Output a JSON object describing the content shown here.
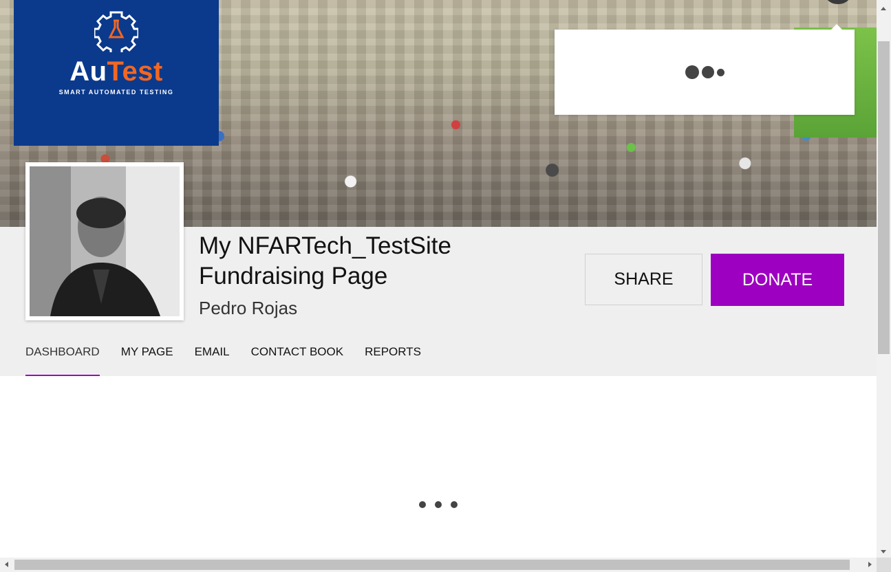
{
  "header": {
    "logo": {
      "wordmark_part1": "Au",
      "wordmark_part2": "Test",
      "tagline": "SMART AUTOMATED TESTING",
      "icon": "gear-flask-icon",
      "background_color": "#0b3a8c",
      "accent_color": "#f26722"
    },
    "cover_photo": "crowd-walking-event-photo",
    "user_menu_popup": {
      "state": "loading"
    }
  },
  "profile": {
    "photo": "profile-photo",
    "page_title": "My NFARTech_TestSite Fundraising Page",
    "owner_name": "Pedro Rojas"
  },
  "actions": {
    "share_label": "SHARE",
    "donate_label": "DONATE",
    "donate_color": "#9d00c0"
  },
  "tabs": [
    {
      "label": "DASHBOARD",
      "active": true
    },
    {
      "label": "MY PAGE",
      "active": false
    },
    {
      "label": "EMAIL",
      "active": false
    },
    {
      "label": "CONTACT BOOK",
      "active": false
    },
    {
      "label": "REPORTS",
      "active": false
    }
  ],
  "content": {
    "state": "loading"
  }
}
